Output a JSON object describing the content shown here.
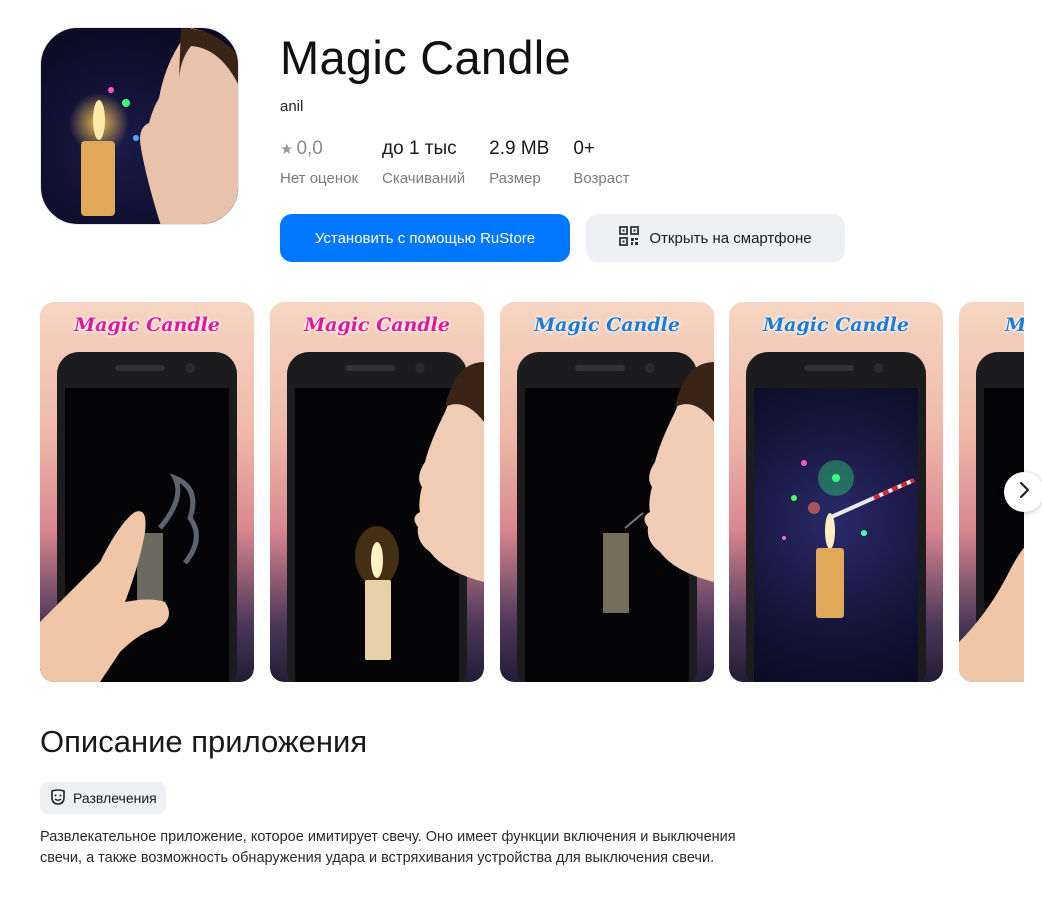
{
  "app": {
    "title": "Magic Candle",
    "developer": "anil"
  },
  "stats": [
    {
      "value": "0,0",
      "label": "Нет оценок",
      "icon": "star-icon"
    },
    {
      "value": "до 1 тыс",
      "label": "Скачиваний"
    },
    {
      "value": "2.9 MB",
      "label": "Размер"
    },
    {
      "value": "0+",
      "label": "Возраст"
    }
  ],
  "buttons": {
    "install": "Установить с помощью RuStore",
    "open_phone": "Открыть на смартфоне"
  },
  "screenshots": [
    {
      "title": "Magic Candle",
      "style": "pink"
    },
    {
      "title": "Magic Candle",
      "style": "pink"
    },
    {
      "title": "Magic Candle",
      "style": "blue"
    },
    {
      "title": "Magic Candle",
      "style": "blue"
    },
    {
      "title": "M",
      "style": "blue"
    }
  ],
  "description": {
    "heading": "Описание приложения",
    "category": "Развлечения",
    "text": "Развлекательное приложение, которое имитирует свечу. Оно имеет функции включения и выключения свечи, а также возможность обнаружения удара и встряхивания устройства для выключения свечи."
  },
  "colors": {
    "accent": "#0077ff",
    "secondary_button": "#eef0f3"
  }
}
